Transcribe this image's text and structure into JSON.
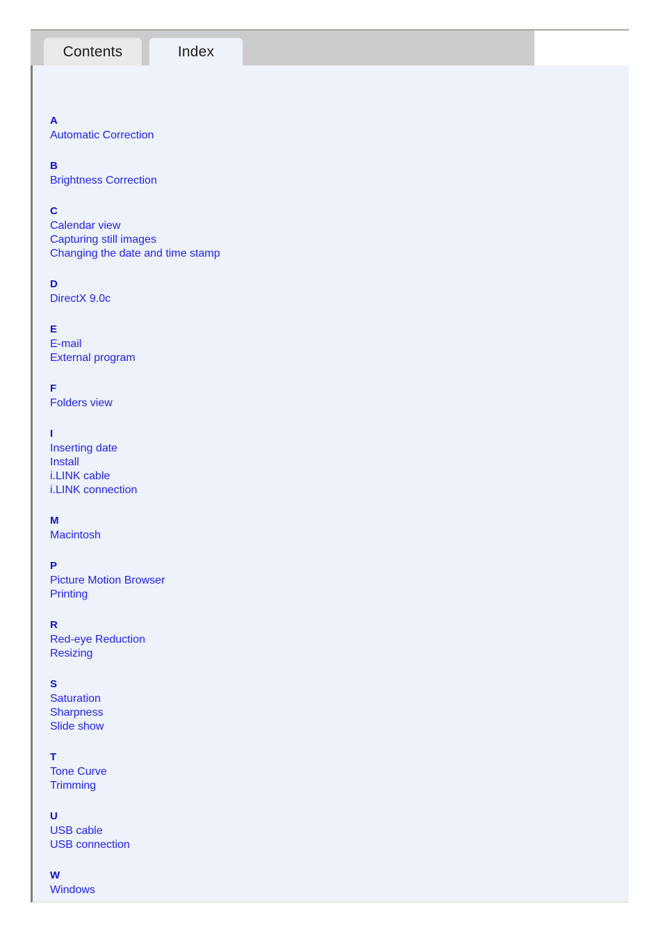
{
  "window": {
    "tabs": [
      {
        "id": "contents",
        "label": "Contents",
        "active": false
      },
      {
        "id": "index",
        "label": "Index",
        "active": true
      }
    ]
  },
  "colors": {
    "tabstrip_background": "#cccccc",
    "inactive_tab": "#e9e9e9",
    "active_tab": "#eef2fa",
    "panel_background": "#eef2fa",
    "letter_heading": "#1111cc",
    "entry_link": "#2222ee",
    "panel_left_border": "#807e74",
    "window_top_rule": "#a6a49b"
  },
  "index": {
    "sections": [
      {
        "letter": "A",
        "entries": [
          "Automatic Correction"
        ]
      },
      {
        "letter": "B",
        "entries": [
          "Brightness Correction"
        ]
      },
      {
        "letter": "C",
        "entries": [
          "Calendar view",
          "Capturing still images",
          "Changing the date and time stamp"
        ]
      },
      {
        "letter": "D",
        "entries": [
          "DirectX 9.0c"
        ]
      },
      {
        "letter": "E",
        "entries": [
          "E-mail",
          "External program"
        ]
      },
      {
        "letter": "F",
        "entries": [
          "Folders view"
        ]
      },
      {
        "letter": "I",
        "entries": [
          "Inserting date",
          "Install",
          "i.LINK cable",
          "i.LINK connection"
        ]
      },
      {
        "letter": "M",
        "entries": [
          "Macintosh"
        ]
      },
      {
        "letter": "P",
        "entries": [
          "Picture Motion Browser",
          "Printing"
        ]
      },
      {
        "letter": "R",
        "entries": [
          "Red-eye Reduction",
          "Resizing"
        ]
      },
      {
        "letter": "S",
        "entries": [
          "Saturation",
          "Sharpness",
          "Slide show"
        ]
      },
      {
        "letter": "T",
        "entries": [
          "Tone Curve",
          "Trimming"
        ]
      },
      {
        "letter": "U",
        "entries": [
          "USB cable",
          "USB connection"
        ]
      },
      {
        "letter": "W",
        "entries": [
          "Windows"
        ]
      }
    ]
  }
}
